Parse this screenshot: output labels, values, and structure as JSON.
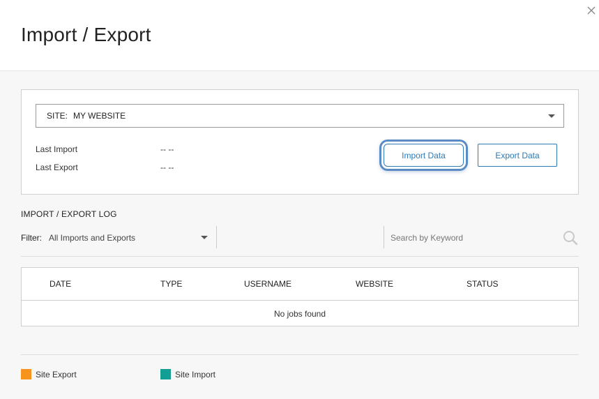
{
  "header": {
    "title": "Import / Export"
  },
  "site_panel": {
    "site_prefix": "SITE:",
    "site_value": "MY WEBSITE",
    "last_import_label": "Last Import",
    "last_import_value": "-- --",
    "last_export_label": "Last Export",
    "last_export_value": "-- --",
    "import_button": "Import Data",
    "export_button": "Export Data"
  },
  "log": {
    "title": "IMPORT / EXPORT LOG",
    "filter_label": "Filter:",
    "filter_value": "All Imports and Exports",
    "search_placeholder": "Search by Keyword",
    "columns": [
      "DATE",
      "TYPE",
      "USERNAME",
      "WEBSITE",
      "STATUS"
    ],
    "empty_message": "No jobs found"
  },
  "legend": {
    "items": [
      {
        "label": "Site Export",
        "color": "#f7941d"
      },
      {
        "label": "Site Import",
        "color": "#139e94"
      }
    ]
  },
  "colors": {
    "accent": "#2d7ab5",
    "focus_ring": "#5a8bc4"
  }
}
